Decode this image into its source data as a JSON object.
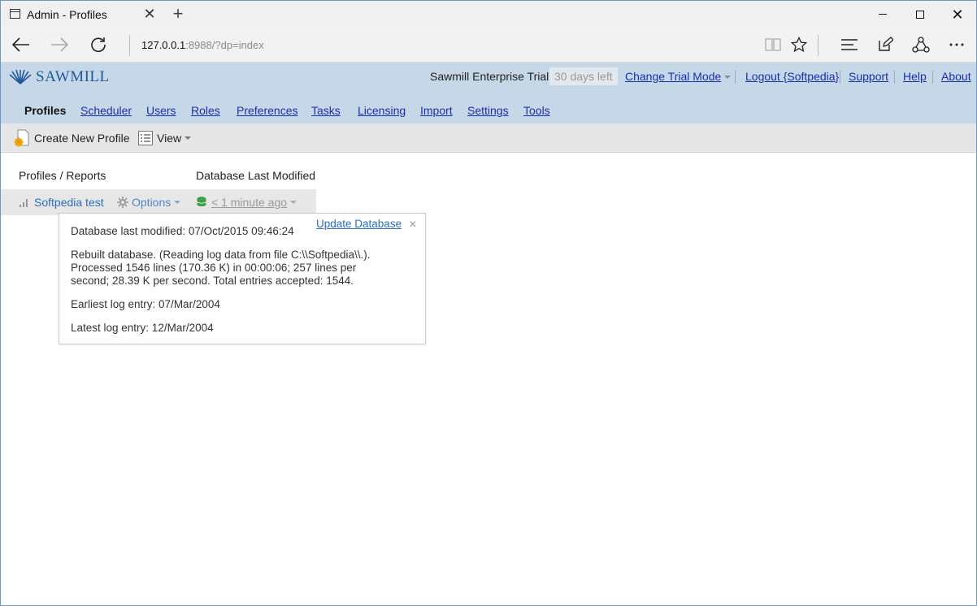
{
  "browser": {
    "tab_title": "Admin - Profiles",
    "tab_close": "✕",
    "new_tab": "+",
    "url_host": "127.0.0.1",
    "url_path": ":8988/?dp=index"
  },
  "app": {
    "logo_text": "SAWMILL",
    "trial_label": "Sawmill Enterprise Trial",
    "days_left": "30 days left",
    "top_links": {
      "change_trial": "Change Trial Mode",
      "logout": "Logout {Softpedia}",
      "support": "Support",
      "help": "Help",
      "about": "About"
    },
    "nav": {
      "profiles": "Profiles",
      "scheduler": "Scheduler",
      "users": "Users",
      "roles": "Roles",
      "preferences": "Preferences",
      "tasks": "Tasks",
      "licensing": "Licensing",
      "import": "Import",
      "settings": "Settings",
      "tools": "Tools"
    },
    "toolbar": {
      "create_new_profile": "Create New Profile",
      "view": "View"
    },
    "columns": {
      "profiles_reports": "Profiles / Reports",
      "db_last_modified": "Database Last Modified"
    },
    "profile_row": {
      "name": "Softpedia test",
      "options": "Options",
      "db_modified": "< 1 minute ago"
    },
    "popup": {
      "update_database": "Update Database",
      "close": "×",
      "line_modified": "Database last modified: 07/Oct/2015 09:46:24",
      "line_rebuilt_1": "Rebuilt database. (Reading log data from file C:\\\\Softpedia\\\\.).",
      "line_rebuilt_2": "Processed 1546 lines (170.36 K) in 00:00:06; 257 lines per",
      "line_rebuilt_3": "second; 28.39 K per second. Total entries accepted: 1544.",
      "line_earliest": "Earliest log entry: 07/Mar/2004",
      "line_latest": "Latest log entry: 12/Mar/2004"
    },
    "colors": {
      "header_bg": "#c6d7e7",
      "link": "#1a2fb0",
      "profile_link": "#2a6ebb",
      "db_icon": "#3aa04a"
    }
  }
}
